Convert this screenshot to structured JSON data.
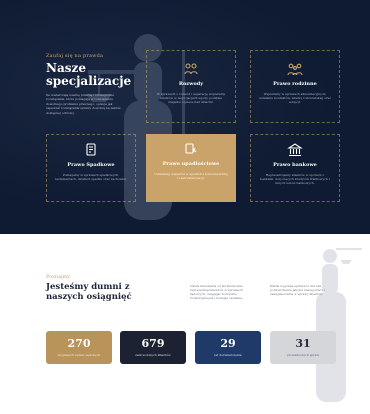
{
  "hero": {
    "eyebrow": "Zaufaj się na prawda",
    "title": "Nasze specjalizacje",
    "lead": "Sa dostarczają wiedzę prawną i strategiczne rozwiązania, które pomagają w rozwiązaniu dowolnego problemu prawnego, opisuje jak zapewnić rozwiązania sprawy dowolną na zakres dostępnej ochrony."
  },
  "cards": [
    {
      "title": "Rozwody",
      "desc": "W sprawach o rozwód i separację wspieramy klientów w negocjacjach ugody, podziale majątku i opiece nad dziećmi.",
      "icon": "divorce-icon"
    },
    {
      "title": "Prawo rodzinne",
      "desc": "Wspieramy w sprawach alimentacyjnych, ustalaniu kontaktów, władzy rodzicielskiej oraz adopcji.",
      "icon": "family-icon"
    },
    {
      "title": "Prawo Spadkowe",
      "desc": "Pomagamy w sprawach spadkowych, testamentach, działach spadku oraz zachowku.",
      "icon": "inheritance-icon"
    },
    {
      "title": "Prawo upadłościowe",
      "desc": "Udzielamy wsparcia w upadłości konsumenckiej i restrukturyzacji.",
      "icon": "bankruptcy-icon"
    },
    {
      "title": "Prawo bankowe",
      "desc": "Reprezentujemy klientów w sporach z bankami, dotyczących kredytów frankowych i innych umów bankowych.",
      "icon": "bank-icon"
    }
  ],
  "stats": {
    "eyebrow": "Poznajmy",
    "title": "Jesteśmy dumni z naszych osiągnięć",
    "para1": "Nasza kancelaria od lat skutecznie reprezentuje klientów w sprawach sądowych, osiągając korzystne rozstrzygnięcia i budując zaufanie.",
    "para2": "Każda wygrana sprawa to dla nas potwierdzenie jakości naszej pracy i zaangażowania w sprawy klientów.",
    "items": [
      {
        "value": "270",
        "label": "wygranych spraw sądowych",
        "color": "#b8935a"
      },
      {
        "value": "679",
        "label": "zadowolonych klientów",
        "color": "#1d2233"
      },
      {
        "value": "29",
        "label": "lat doświadczenia",
        "color": "#1f3a68"
      },
      {
        "value": "31",
        "label": "prowadzonych spraw",
        "color": "#d4d6da"
      }
    ]
  },
  "colors": {
    "navy": "#0f1b33",
    "gold": "#c8a56a"
  }
}
